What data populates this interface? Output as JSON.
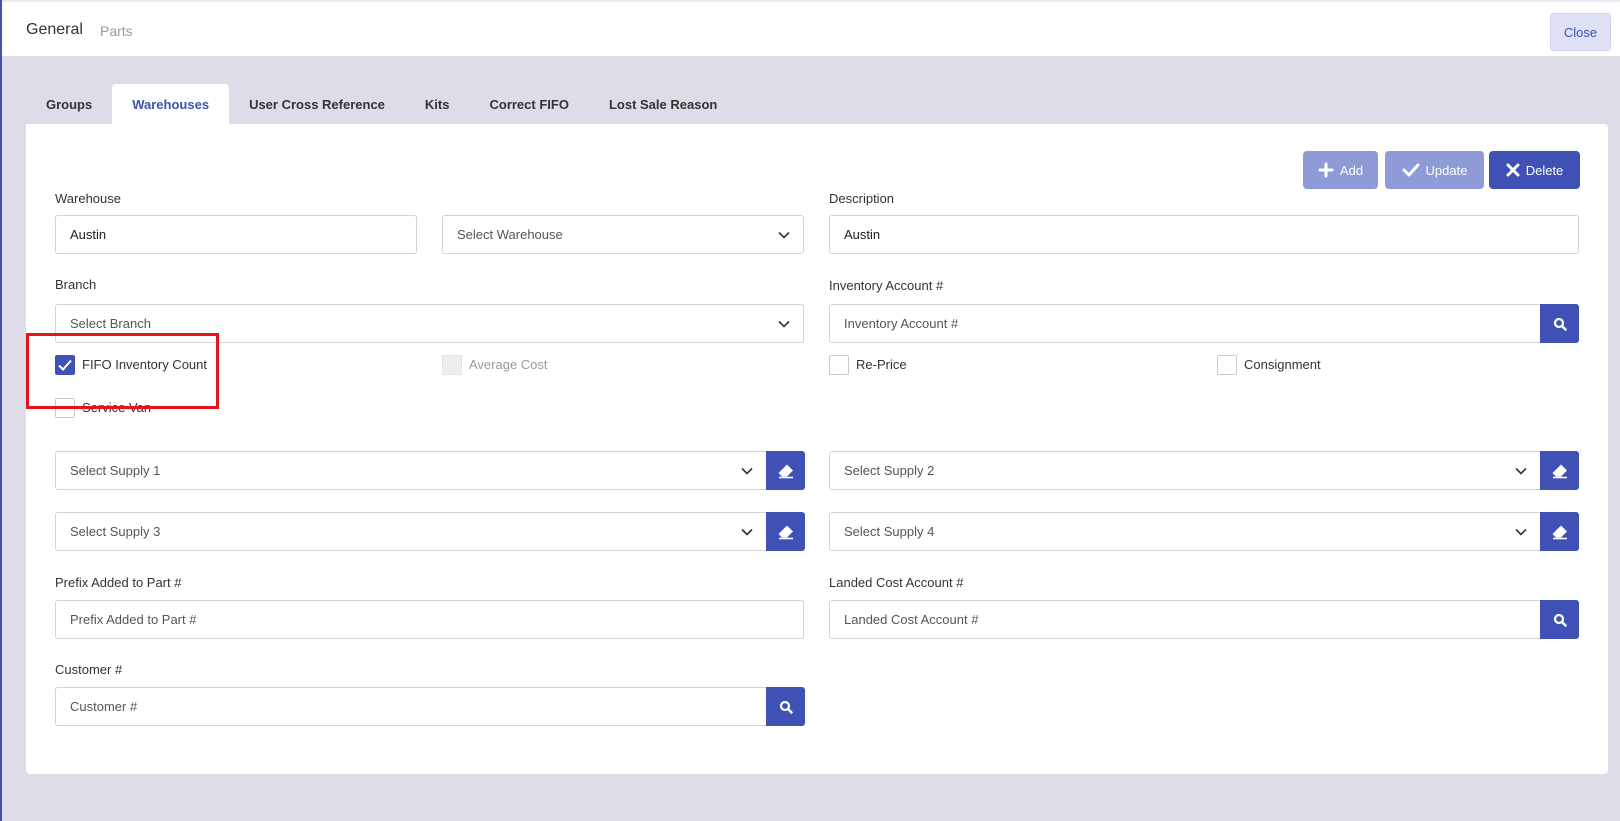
{
  "header": {
    "title": "General",
    "subtitle": "Parts",
    "close_label": "Close"
  },
  "tabs": [
    {
      "label": "Groups",
      "active": false
    },
    {
      "label": "Warehouses",
      "active": true
    },
    {
      "label": "User Cross Reference",
      "active": false
    },
    {
      "label": "Kits",
      "active": false
    },
    {
      "label": "Correct FIFO",
      "active": false
    },
    {
      "label": "Lost Sale Reason",
      "active": false
    }
  ],
  "actions": {
    "add_label": "Add",
    "update_label": "Update",
    "delete_label": "Delete"
  },
  "form": {
    "warehouse_label": "Warehouse",
    "warehouse_value": "Austin",
    "warehouse_select_placeholder": "Select Warehouse",
    "description_label": "Description",
    "description_value": "Austin",
    "branch_label": "Branch",
    "branch_placeholder": "Select Branch",
    "inventory_account_label": "Inventory Account #",
    "inventory_account_placeholder": "Inventory Account #",
    "fifo_label": "FIFO Inventory Count",
    "fifo_checked": true,
    "average_cost_label": "Average Cost",
    "reprice_label": "Re-Price",
    "consignment_label": "Consignment",
    "service_van_label": "Service Van",
    "supply1_placeholder": "Select Supply 1",
    "supply2_placeholder": "Select Supply 2",
    "supply3_placeholder": "Select Supply 3",
    "supply4_placeholder": "Select Supply 4",
    "prefix_label": "Prefix Added to Part #",
    "prefix_placeholder": "Prefix Added to Part #",
    "landed_cost_label": "Landed Cost Account #",
    "landed_cost_placeholder": "Landed Cost Account #",
    "customer_label": "Customer #",
    "customer_placeholder": "Customer #"
  },
  "colors": {
    "accent": "#3f51b5",
    "accent_light": "#8e9bd6",
    "highlight": "#e4141b",
    "background": "#dddde7"
  }
}
